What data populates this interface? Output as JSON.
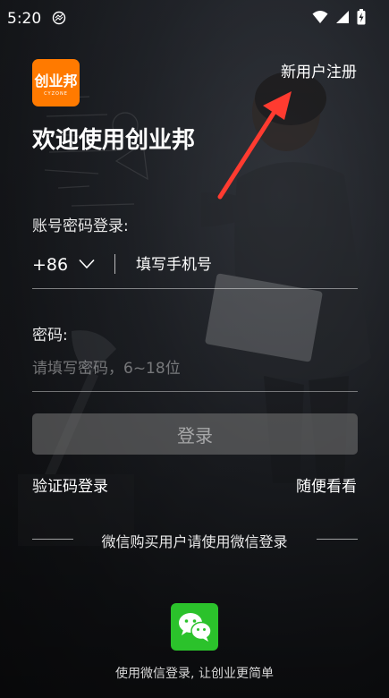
{
  "status_bar": {
    "time": "5:20"
  },
  "header": {
    "register_link": "新用户注册"
  },
  "brand": {
    "logo_text": "创业邦",
    "logo_subtext": "CYZONE",
    "welcome_title": "欢迎使用创业邦"
  },
  "form": {
    "account_label": "账号密码登录:",
    "country_code": "+86",
    "phone_placeholder": "填写手机号",
    "password_label": "密码:",
    "password_placeholder": "请填写密码，6~18位",
    "login_button": "登录"
  },
  "links": {
    "code_login": "验证码登录",
    "browse": "随便看看"
  },
  "wechat": {
    "tip": "微信购买用户请使用微信登录",
    "caption": "使用微信登录, 让创业更简单"
  },
  "colors": {
    "brand_orange": "#ff7a00",
    "wechat_green": "#2bc22b",
    "arrow_red": "#ff3b30"
  }
}
